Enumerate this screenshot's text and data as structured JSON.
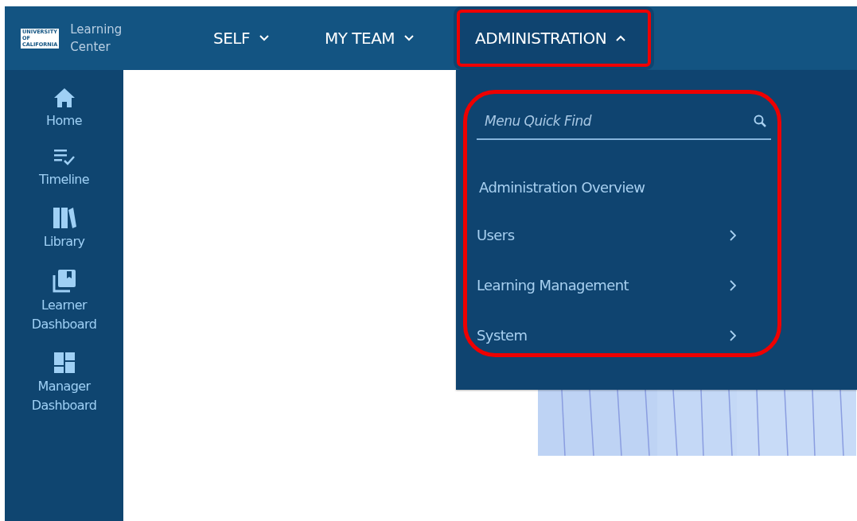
{
  "header": {
    "logo": {
      "lines": [
        "UNIVERSITY",
        "OF",
        "CALIFORNIA"
      ],
      "title_lines": [
        "Learning",
        "Center"
      ]
    },
    "nav": [
      {
        "label": "SELF",
        "expanded": false,
        "highlighted": false
      },
      {
        "label": "MY TEAM",
        "expanded": false,
        "highlighted": false
      },
      {
        "label": "ADMINISTRATION",
        "expanded": true,
        "highlighted": true
      }
    ]
  },
  "sidebar": {
    "items": [
      {
        "label": "Home"
      },
      {
        "label": "Timeline"
      },
      {
        "label": "Library"
      },
      {
        "label": "Learner Dashboard"
      },
      {
        "label": "Manager Dashboard"
      }
    ]
  },
  "admin_menu": {
    "highlighted": true,
    "search": {
      "placeholder": "Menu Quick Find"
    },
    "items": [
      {
        "label": "Administration Overview",
        "has_submenu": false
      },
      {
        "label": "Users",
        "has_submenu": true
      },
      {
        "label": "Learning Management",
        "has_submenu": true
      },
      {
        "label": "System",
        "has_submenu": true
      }
    ]
  }
}
